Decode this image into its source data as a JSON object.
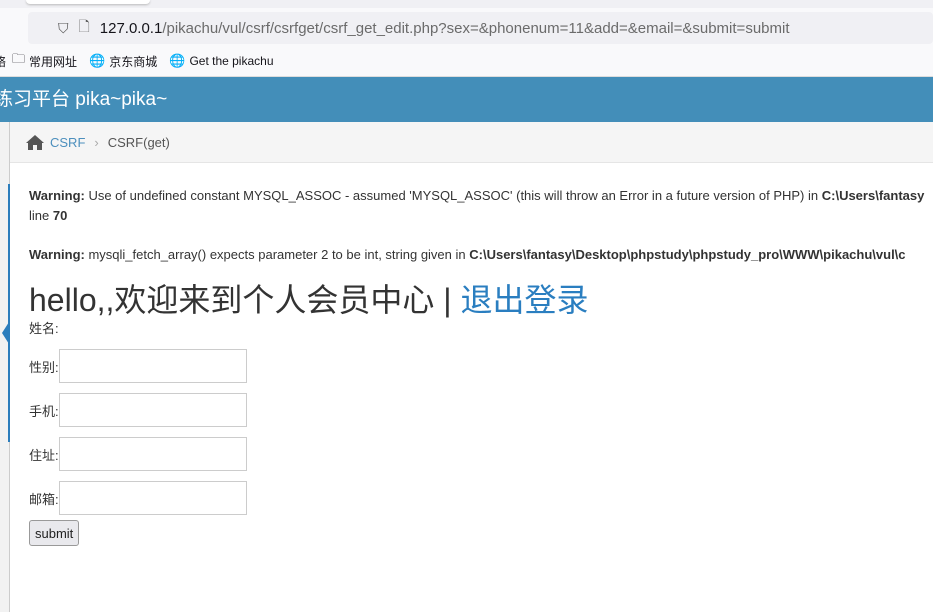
{
  "browser": {
    "url_host": "127.0.0.1",
    "url_path": "/pikachu/vul/csrf/csrfget/csrf_get_edit.php?sex=&phonenum=11&add=&email=&submit=submit",
    "bookmarks": [
      {
        "label": "常用网址",
        "icon": "folder-icon"
      },
      {
        "label": "京东商城",
        "icon": "globe-icon"
      },
      {
        "label": "Get the pikachu",
        "icon": "globe-icon"
      }
    ],
    "bookmark_cutoff": "络"
  },
  "header": {
    "title": "练习平台 pika~pika~"
  },
  "breadcrumb": {
    "home_icon": "home-icon",
    "items": [
      "CSRF",
      "CSRF(get)"
    ]
  },
  "warnings": [
    {
      "label": "Warning:",
      "text": " Use of undefined constant MYSQL_ASSOC - assumed 'MYSQL_ASSOC' (this will throw an Error in a future version of PHP) in ",
      "path": "C:\\Users\\fantasy",
      "line_label": "line ",
      "line": "70"
    },
    {
      "label": "Warning:",
      "text": " mysqli_fetch_array() expects parameter 2 to be int, string given in ",
      "path": "C:\\Users\\fantasy\\Desktop\\phpstudy\\phpstudy_pro\\WWW\\pikachu\\vul\\c"
    }
  ],
  "main": {
    "greeting": "hello,,欢迎来到个人会员中心 | ",
    "logout": "退出登录",
    "name_label": "姓名:",
    "fields": [
      {
        "label": "性别:",
        "value": ""
      },
      {
        "label": "手机:",
        "value": ""
      },
      {
        "label": "住址:",
        "value": ""
      },
      {
        "label": "邮箱:",
        "value": ""
      }
    ],
    "submit": "submit"
  },
  "colors": {
    "header": "#438eb9",
    "link": "#2a7ec0"
  }
}
